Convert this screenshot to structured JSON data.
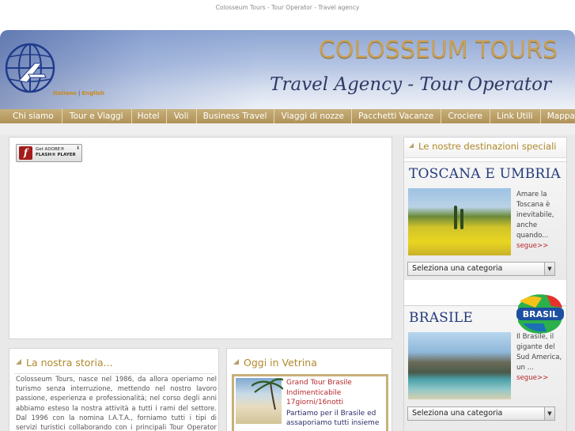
{
  "page": {
    "top_title": "Colosseum Tours - Tour Operator - Travel agency"
  },
  "header": {
    "brand": "COLOSSEUM TOURS",
    "tagline": "Travel Agency - Tour Operator",
    "lang_it": "Italiano",
    "lang_sep": "|",
    "lang_en": "English"
  },
  "nav": {
    "items": [
      {
        "label": "Chi siamo"
      },
      {
        "label": "Tour e Viaggi"
      },
      {
        "label": "Hotel"
      },
      {
        "label": "Voli"
      },
      {
        "label": "Business Travel"
      },
      {
        "label": "Viaggi di nozze"
      },
      {
        "label": "Pacchetti Vacanze"
      },
      {
        "label": "Crociere"
      },
      {
        "label": "Link Utili"
      },
      {
        "label": "Mappa"
      }
    ]
  },
  "flash": {
    "line1": "Get ADOBE®",
    "line2": "FLASH® PLAYER"
  },
  "story": {
    "title": "La nostra storia...",
    "text": "Colosseum Tours, nasce nel 1986, da allora operiamo nel turismo senza interruzione, mettendo nel nostro lavoro passione, esperienza e professionalità; nel corso degli anni abbiamo esteso la nostra attività a tutti i rami del settore. Dal 1996 con la nomina I.A.T.A., forniamo tutti i tipi di servizi turistici collaborando con i principali Tour Operator nazionali"
  },
  "vetrina": {
    "title": "Oggi in Vetrina",
    "offer_title": "Grand Tour Brasile Indimenticabile",
    "offer_duration": "17giorni/16notti",
    "offer_desc": "Partiamo per il Brasile ed assaporiamo tutti insieme"
  },
  "destinations": {
    "title": "Le nostre destinazioni speciali",
    "items": [
      {
        "heading": "TOSCANA E UMBRIA",
        "desc": "Amare la Toscana è inevitabile, anche quando...",
        "more": "segue>>",
        "select": "Seleziona una categoria"
      },
      {
        "heading": "BRASILE",
        "desc": "Il Brasile, il gigante del Sud America, un ...",
        "more": "segue>>",
        "select": "Seleziona una categoria",
        "logo_text": "BRASIL"
      }
    ]
  },
  "colors": {
    "nav_bg": "#b8a06a",
    "accent_gold": "#b08a2c",
    "link_red": "#b5282c",
    "brand_gold": "#c8a05a",
    "tagline_blue": "#2f3a66"
  },
  "icons": [
    "globe-logo-icon",
    "flash-player-icon",
    "select-arrow-icon",
    "brasil-logo-icon"
  ]
}
